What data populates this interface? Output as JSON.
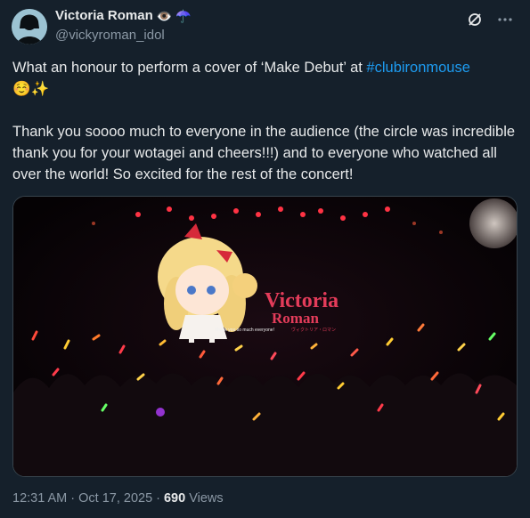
{
  "author": {
    "display_name": "Victoria Roman",
    "name_emojis": [
      "👁️",
      "☂️"
    ],
    "handle": "@vickyroman_idol"
  },
  "tweet": {
    "line1_prefix": "What an honour to perform a cover of ‘Make Debut’ at ",
    "hashtag": "#clubironmouse",
    "line1_emojis": "☺️✨",
    "paragraph2": "Thank you soooo much to everyone in the audience (the circle was incredible thank you for your wotagei and cheers!!!) and to everyone who watched all over the world! So excited for the rest of the concert!"
  },
  "media": {
    "screen_title_line1": "Victoria",
    "screen_title_line2": "Roman",
    "screen_subtitle": "ヴィクトリア・ロマン",
    "screen_caption": "Thank you so much everyone!"
  },
  "footer": {
    "time": "12:31 AM",
    "separator": "·",
    "date": "Oct 17, 2025",
    "views_count": "690",
    "views_label": "Views"
  },
  "colors": {
    "background": "#15202b",
    "link": "#1d9bf0",
    "muted": "#8b98a5"
  },
  "icons": [
    "grok-icon",
    "more-icon"
  ]
}
